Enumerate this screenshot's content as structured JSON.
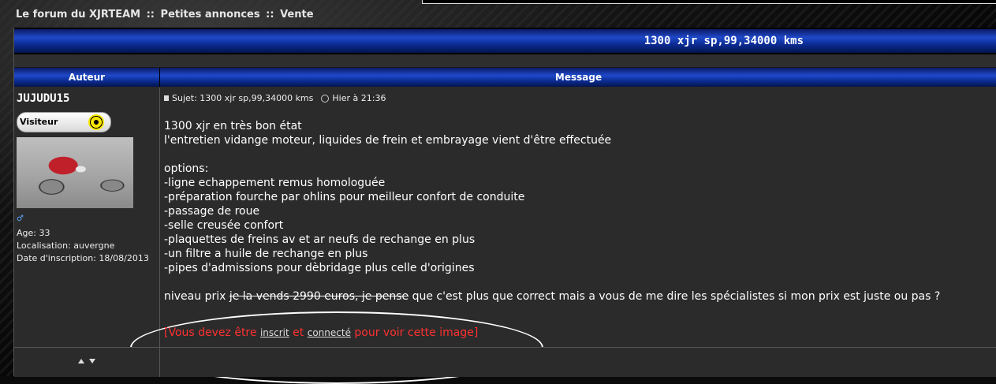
{
  "breadcrumb": {
    "forum": "Le forum du XJRTEAM",
    "sep1": "::",
    "section": "Petites annonces",
    "sep2": "::",
    "subsection": "Vente"
  },
  "topic": {
    "title": "1300 xjr sp,99,34000 kms"
  },
  "table": {
    "col_author": "Auteur",
    "col_message": "Message"
  },
  "author": {
    "username": "JUJUDU15",
    "rank": "Visiteur",
    "gender_icon": "male-symbol-icon",
    "age": "Age: 33",
    "location": "Localisation: auvergne",
    "joined": "Date d'inscription: 18/08/2013"
  },
  "post": {
    "subject": "Sujet: 1300 xjr sp,99,34000 kms",
    "time": "Hier à 21:36",
    "lines": [
      "1300 xjr en très bon état",
      "l'entretien vidange moteur, liquides de frein et embrayage vient d'être effectuée",
      "",
      "options:",
      "-ligne echappement remus homologuée",
      "-préparation fourche par ohlins pour meilleur confort de conduite",
      "-passage de roue",
      "-selle creusée confort",
      "-plaquettes de freins av et ar neufs de rechange en plus",
      "-un filtre a huile de rechange en plus",
      "-pipes d'admissions pour dèbridage plus celle d'origines",
      ""
    ],
    "price_before": "niveau prix ",
    "price_struck": "je la vends 2990 euros, je pense",
    "price_after": " que c'est plus que correct mais a vous de me dire les spécialistes si mon prix est juste ou pas ?",
    "locked_prefix": "[Vous devez être ",
    "locked_link1": "inscrit",
    "locked_mid": " et ",
    "locked_link2": "connecté",
    "locked_suffix": " pour voir cette image]"
  },
  "colors": {
    "header_blue": "#1f49c9",
    "locked_text": "#ff3030",
    "background": "#2b2b2b"
  }
}
